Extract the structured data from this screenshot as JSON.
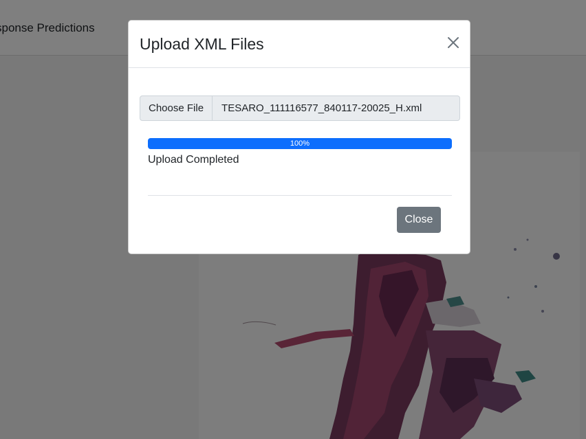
{
  "app": {
    "nav_title": "sponse Predictions"
  },
  "modal": {
    "title": "Upload XML Files",
    "close_icon": "close-icon",
    "file_input": {
      "button_label": "Choose File",
      "file_name": "TESARO_111116577_840117-20025_H.xml"
    },
    "progress": {
      "value": 1.0,
      "label": "100%"
    },
    "status_text": "Upload Completed",
    "close_button_label": "Close"
  },
  "colors": {
    "accent": "#0d6efd",
    "secondary": "#6c757d",
    "backdrop": "rgba(0,0,0,0.5)"
  }
}
